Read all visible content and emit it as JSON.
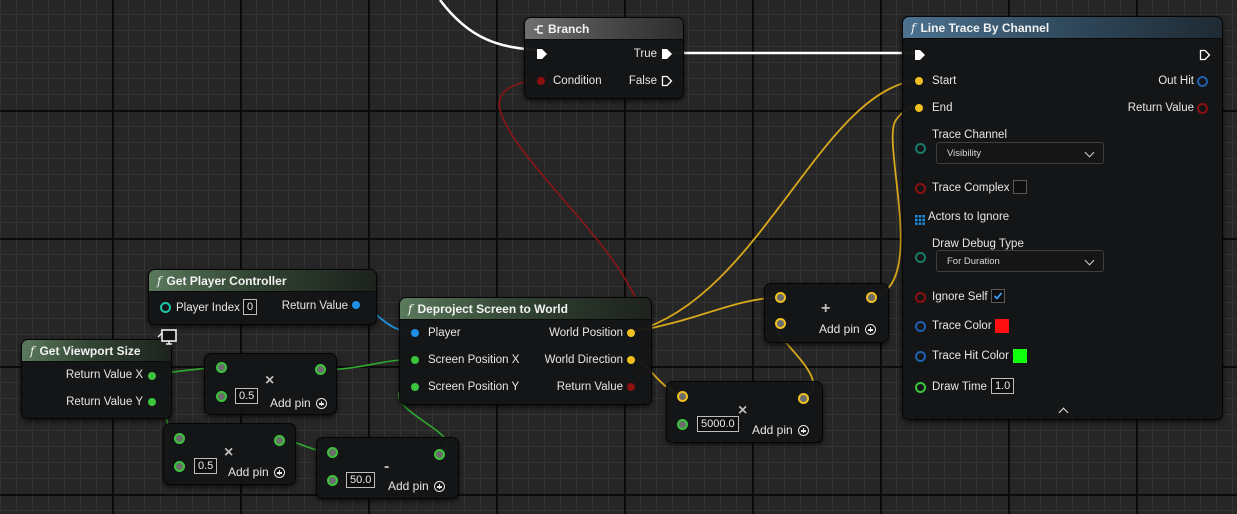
{
  "colors": {
    "exec": "#ffffff",
    "bool": "#8c1010",
    "vector": "#f0c020",
    "float": "#3cc43c",
    "object": "#1e90e6",
    "struct": "#1f5fb0",
    "channel": "#1a7a6a"
  },
  "nodes": {
    "branch": {
      "title": "Branch",
      "icon": "branch-icon",
      "true_label": "True",
      "condition_label": "Condition",
      "false_label": "False"
    },
    "line_trace": {
      "fn_symbol": "f",
      "title": "Line Trace By Channel",
      "start_label": "Start",
      "end_label": "End",
      "out_hit_label": "Out Hit",
      "return_value_label": "Return Value",
      "trace_channel_label": "Trace Channel",
      "trace_channel_value": "Visibility",
      "trace_complex_label": "Trace Complex",
      "actors_to_ignore_label": "Actors to Ignore",
      "draw_debug_type_label": "Draw Debug Type",
      "draw_debug_type_value": "For Duration",
      "ignore_self_label": "Ignore Self",
      "trace_color_label": "Trace Color",
      "trace_color": "#ff1010",
      "trace_hit_color_label": "Trace Hit Color",
      "trace_hit_color": "#10ff10",
      "draw_time_label": "Draw Time",
      "draw_time_value": "1.0",
      "expand_icon": "chevron-up-icon"
    },
    "get_player_controller": {
      "fn_symbol": "f",
      "title": "Get Player Controller",
      "player_index_label": "Player Index",
      "player_index_value": "0",
      "return_value_label": "Return Value"
    },
    "deproject": {
      "fn_symbol": "f",
      "title": "Deproject Screen to World",
      "player_label": "Player",
      "screen_pos_x_label": "Screen Position X",
      "screen_pos_y_label": "Screen Position Y",
      "world_position_label": "World Position",
      "world_direction_label": "World Direction",
      "return_value_label": "Return Value"
    },
    "get_viewport_size": {
      "fn_symbol": "f",
      "title": "Get Viewport Size",
      "return_x_label": "Return Value X",
      "return_y_label": "Return Value Y",
      "client_icon": "monitor-icon"
    },
    "multiply_x": {
      "op": "×",
      "value": "0.5",
      "add_pin_label": "Add pin"
    },
    "multiply_y": {
      "op": "×",
      "value": "0.5",
      "add_pin_label": "Add pin"
    },
    "subtract": {
      "op": "-",
      "value": "50.0",
      "add_pin_label": "Add pin"
    },
    "add_vector": {
      "op": "+",
      "add_pin_label": "Add pin"
    },
    "multiply_vector": {
      "op": "×",
      "value": "5000.0",
      "add_pin_label": "Add pin"
    }
  }
}
